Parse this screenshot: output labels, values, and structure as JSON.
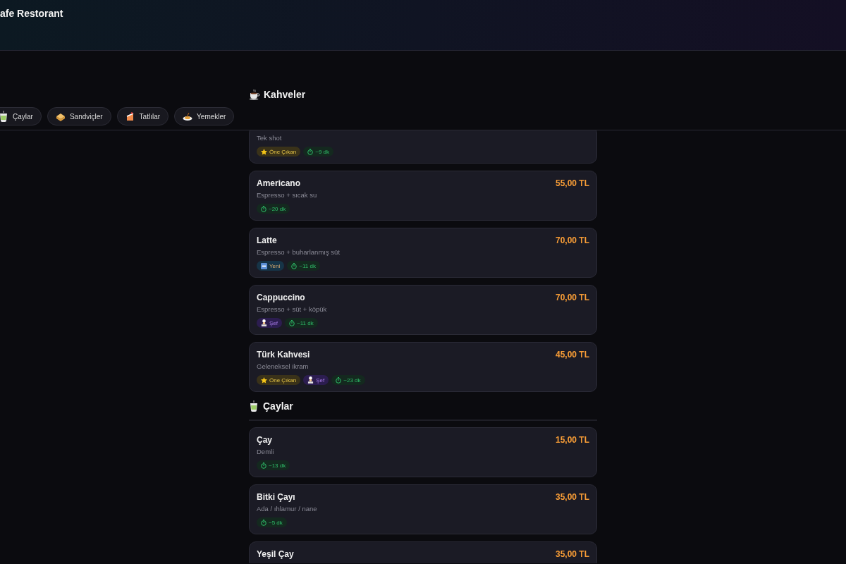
{
  "header": {
    "title": "afe Restorant"
  },
  "sticky_bar": {
    "heading": {
      "kind": "coffee",
      "title": "Kahveler"
    },
    "category_chips": [
      {
        "kind": "tea",
        "label": "Çaylar"
      },
      {
        "kind": "sandwich",
        "label": "Sandviçler"
      },
      {
        "kind": "dessert",
        "label": "Tatlılar"
      },
      {
        "kind": "meal",
        "label": "Yemekler"
      }
    ]
  },
  "sections": [
    {
      "items": [
        {
          "description": "Tek shot",
          "badges": [
            {
              "kind": "featured",
              "label": "Öne Çıkan"
            },
            {
              "kind": "time",
              "label": "~9 dk"
            }
          ]
        },
        {
          "name": "Americano",
          "price": "55,00 TL",
          "description": "Espresso + sıcak su",
          "badges": [
            {
              "kind": "time",
              "label": "~20 dk"
            }
          ]
        },
        {
          "name": "Latte",
          "price": "70,00 TL",
          "description": "Espresso + buharlanmış süt",
          "badges": [
            {
              "kind": "new",
              "label": "Yeni"
            },
            {
              "kind": "time",
              "label": "~11 dk"
            }
          ]
        },
        {
          "name": "Cappuccino",
          "price": "70,00 TL",
          "description": "Espresso + süt + köpük",
          "badges": [
            {
              "kind": "chef",
              "label": "Şef"
            },
            {
              "kind": "time",
              "label": "~11 dk"
            }
          ]
        },
        {
          "name": "Türk Kahvesi",
          "price": "45,00 TL",
          "description": "Geleneksel ikram",
          "badges": [
            {
              "kind": "featured",
              "label": "Öne Çıkan"
            },
            {
              "kind": "chef",
              "label": "Şef"
            },
            {
              "kind": "time",
              "label": "~23 dk"
            }
          ]
        }
      ]
    },
    {
      "heading": {
        "kind": "tea",
        "title": "Çaylar"
      },
      "items": [
        {
          "name": "Çay",
          "price": "15,00 TL",
          "description": "Demli",
          "badges": [
            {
              "kind": "time",
              "label": "~13 dk"
            }
          ]
        },
        {
          "name": "Bitki Çayı",
          "price": "35,00 TL",
          "description": "Ada / ıhlamur / nane",
          "badges": [
            {
              "kind": "time",
              "label": "~5 dk"
            }
          ]
        },
        {
          "name": "Yeşil Çay",
          "price": "35,00 TL"
        }
      ]
    }
  ]
}
